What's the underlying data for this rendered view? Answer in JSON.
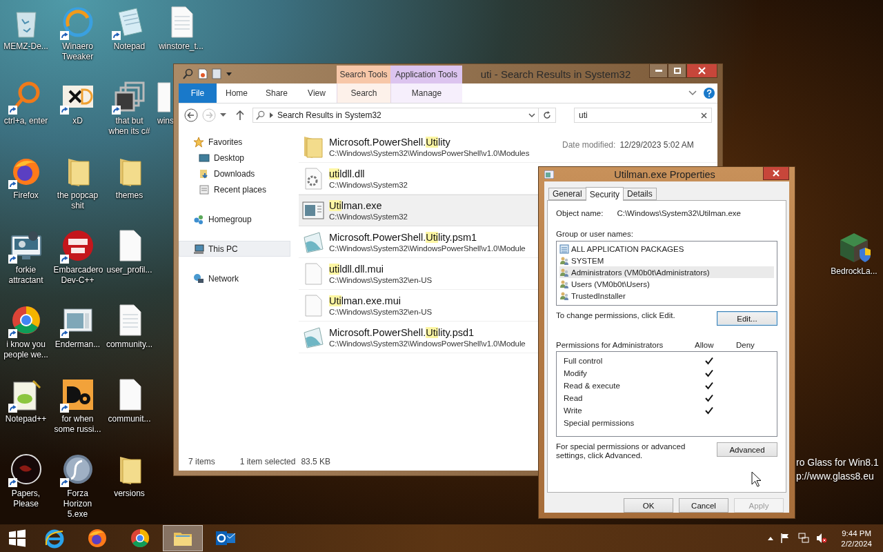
{
  "desktop_icons": [
    [
      {
        "label": "MEMZ-De...",
        "kind": "bin",
        "shortcut": false
      },
      {
        "label": "ctrl+a, enter",
        "kind": "ring",
        "shortcut": true
      },
      {
        "label": "Firefox",
        "kind": "firefox",
        "shortcut": true
      },
      {
        "label": "forkie attractant",
        "kind": "gear-monitor",
        "shortcut": true
      },
      {
        "label": "i know you people we...",
        "kind": "chrome",
        "shortcut": true
      },
      {
        "label": "Notepad++",
        "kind": "notepadpp",
        "shortcut": true
      },
      {
        "label": "Papers, Please",
        "kind": "dark-disc",
        "shortcut": true
      }
    ],
    [
      {
        "label": "Winaero Tweaker",
        "kind": "swirl",
        "shortcut": true
      },
      {
        "label": "xD",
        "kind": "xd",
        "shortcut": true
      },
      {
        "label": "the popcap shit",
        "kind": "folder",
        "shortcut": false
      },
      {
        "label": "Embarcadero Dev-C++",
        "kind": "dev",
        "shortcut": true
      },
      {
        "label": "Enderman...",
        "kind": "window",
        "shortcut": true
      },
      {
        "label": "for when some russi...",
        "kind": "de",
        "shortcut": true
      },
      {
        "label": "Forza Horizon 5.exe",
        "kind": "flash",
        "shortcut": true
      }
    ],
    [
      {
        "label": "Notepad",
        "kind": "notepad",
        "shortcut": true
      },
      {
        "label": "that but when its c#",
        "kind": "stack",
        "shortcut": true
      },
      {
        "label": "themes",
        "kind": "folder",
        "shortcut": false
      },
      {
        "label": "user_profil...",
        "kind": "document",
        "shortcut": false
      },
      {
        "label": "community...",
        "kind": "text",
        "shortcut": false
      },
      {
        "label": "communit...",
        "kind": "document",
        "shortcut": false
      },
      {
        "label": "versions",
        "kind": "folder",
        "shortcut": false
      }
    ],
    [
      {
        "label": "winstore_t...",
        "kind": "text",
        "shortcut": false
      },
      {
        "label": "wins",
        "kind": "partial",
        "shortcut": false
      }
    ]
  ],
  "desktop_right_icon": {
    "label": "BedrockLa...",
    "kind": "cube",
    "shortcut": false
  },
  "desktop_overlay_text": [
    "ro Glass for Win8.1",
    "p://www.glass8.eu"
  ],
  "explorer": {
    "title": "uti - Search Results in System32",
    "ribbon_tabs": [
      {
        "label": "File",
        "kind": "file"
      },
      {
        "label": "Home",
        "kind": "plain"
      },
      {
        "label": "Share",
        "kind": "plain"
      },
      {
        "label": "View",
        "kind": "plain"
      },
      {
        "label": "Search",
        "kind": "search",
        "group": "Search Tools"
      },
      {
        "label": "Manage",
        "kind": "application",
        "group": "Application Tools"
      }
    ],
    "address": "Search Results in System32",
    "search_value": "uti",
    "nav": [
      {
        "label": "Favorites",
        "kind": "star",
        "selected": false,
        "children": [
          {
            "label": "Desktop",
            "kind": "desktop",
            "selected": false
          },
          {
            "label": "Downloads",
            "kind": "downloads",
            "selected": false
          },
          {
            "label": "Recent places",
            "kind": "recent",
            "selected": false
          }
        ]
      },
      {
        "label": "Homegroup",
        "kind": "homegroup",
        "selected": false
      },
      {
        "label": "This PC",
        "kind": "pc",
        "selected": true
      },
      {
        "label": "Network",
        "kind": "network",
        "selected": false
      }
    ],
    "items": [
      {
        "kind": "folder",
        "selected": false,
        "name": [
          {
            "text": "Microsoft.PowerShell.",
            "highlight": false
          },
          {
            "text": "Uti",
            "highlight": true
          },
          {
            "text": "lity",
            "highlight": false
          }
        ],
        "path": "C:\\Windows\\System32\\WindowsPowerShell\\v1.0\\Modules",
        "date_label": "Date modified:",
        "date": "12/29/2023 5:02 AM"
      },
      {
        "kind": "dll",
        "selected": false,
        "name": [
          {
            "text": "uti",
            "highlight": true
          },
          {
            "text": "ldll.dll",
            "highlight": false
          }
        ],
        "path": "C:\\Windows\\System32"
      },
      {
        "kind": "exe",
        "selected": true,
        "name": [
          {
            "text": "Uti",
            "highlight": true
          },
          {
            "text": "lman.exe",
            "highlight": false
          }
        ],
        "path": "C:\\Windows\\System32"
      },
      {
        "kind": "script",
        "selected": false,
        "name": [
          {
            "text": "Microsoft.PowerShell.",
            "highlight": false
          },
          {
            "text": "Uti",
            "highlight": true
          },
          {
            "text": "lity.psm1",
            "highlight": false
          }
        ],
        "path": "C:\\Windows\\System32\\WindowsPowerShell\\v1.0\\Module"
      },
      {
        "kind": "blank",
        "selected": false,
        "name": [
          {
            "text": "uti",
            "highlight": true
          },
          {
            "text": "ldll.dll.mui",
            "highlight": false
          }
        ],
        "path": "C:\\Windows\\System32\\en-US"
      },
      {
        "kind": "blank",
        "selected": false,
        "name": [
          {
            "text": "Uti",
            "highlight": true
          },
          {
            "text": "lman.exe.mui",
            "highlight": false
          }
        ],
        "path": "C:\\Windows\\System32\\en-US"
      },
      {
        "kind": "script",
        "selected": false,
        "name": [
          {
            "text": "Microsoft.PowerShell.",
            "highlight": false
          },
          {
            "text": "Uti",
            "highlight": true
          },
          {
            "text": "lity.psd1",
            "highlight": false
          }
        ],
        "path": "C:\\Windows\\System32\\WindowsPowerShell\\v1.0\\Module"
      }
    ],
    "status": {
      "count": "7 items",
      "selection": "1 item selected",
      "size": "83.5 KB"
    }
  },
  "properties": {
    "title": "Utilman.exe Properties",
    "tabs": [
      {
        "label": "General",
        "selected": false
      },
      {
        "label": "Security",
        "selected": true
      },
      {
        "label": "Details",
        "selected": false
      }
    ],
    "object_label": "Object name:",
    "object_value": "C:\\Windows\\System32\\Utilman.exe",
    "group_label": "Group or user names:",
    "principals": [
      {
        "name": "ALL APPLICATION PACKAGES",
        "kind": "package",
        "selected": false
      },
      {
        "name": "SYSTEM",
        "kind": "users",
        "selected": false
      },
      {
        "name": "Administrators (VM0b0t\\Administrators)",
        "kind": "users",
        "selected": true
      },
      {
        "name": "Users (VM0b0t\\Users)",
        "kind": "users",
        "selected": false
      },
      {
        "name": "TrustedInstaller",
        "kind": "users",
        "selected": false
      }
    ],
    "change_text": "To change permissions, click Edit.",
    "edit_button": {
      "label": "Edit...",
      "focused": true
    },
    "permissions_label": "Permissions for Administrators",
    "allow_label": "Allow",
    "deny_label": "Deny",
    "permissions": [
      {
        "name": "Full control",
        "allow": true,
        "deny": false
      },
      {
        "name": "Modify",
        "allow": true,
        "deny": false
      },
      {
        "name": "Read & execute",
        "allow": true,
        "deny": false
      },
      {
        "name": "Read",
        "allow": true,
        "deny": false
      },
      {
        "name": "Write",
        "allow": true,
        "deny": false
      },
      {
        "name": "Special permissions",
        "allow": false,
        "deny": false
      }
    ],
    "advanced_text": "For special permissions or advanced settings, click Advanced.",
    "advanced_button": {
      "label": "Advanced",
      "focused": false
    },
    "buttons": [
      {
        "label": "OK",
        "disabled": false
      },
      {
        "label": "Cancel",
        "disabled": false
      },
      {
        "label": "Apply",
        "disabled": true
      }
    ]
  },
  "taskbar": {
    "apps": [
      {
        "kind": "ie",
        "active": false
      },
      {
        "kind": "firefox",
        "active": false
      },
      {
        "kind": "chrome",
        "active": false
      },
      {
        "kind": "explorer",
        "active": true
      },
      {
        "kind": "outlook",
        "active": false
      }
    ],
    "clock": {
      "time": "9:44 PM",
      "date": "2/2/2024"
    }
  }
}
